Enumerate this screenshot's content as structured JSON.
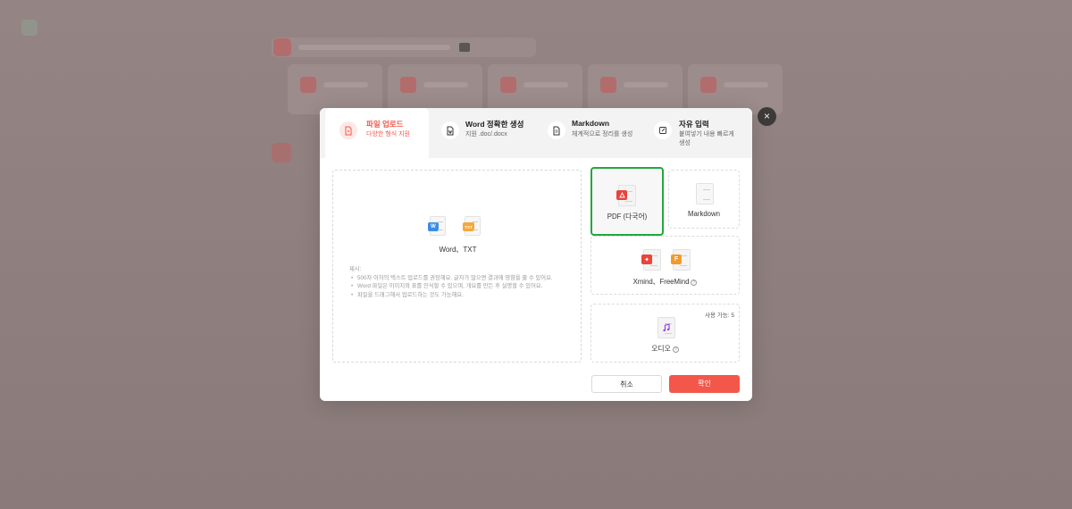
{
  "tabs": [
    {
      "title": "파일 업로드",
      "sub": "다양한 형식 지원",
      "icon": "file-upload-icon"
    },
    {
      "title": "Word 정확한 생성",
      "sub": "지원 .doc/.docx",
      "icon": "word-doc-icon"
    },
    {
      "title": "Markdown",
      "sub": "체계적으로 정리를 생성",
      "icon": "markdown-doc-icon"
    },
    {
      "title": "자유 입력",
      "sub": "붙여넣기 내용 빠르게 생성",
      "icon": "edit-icon"
    }
  ],
  "dropzone": {
    "label": "Word、TXT",
    "hint_title": "제시:",
    "hints": [
      "500자 이하의 텍스트 업로드를 권장해요. 글자가 많으면 결과에 영향을 줄 수 있어요.",
      "Word 파일은 이미지와 표를 인식할 수 있으며, 개요를 만든 후 설명할 수 있어요.",
      "파일을 드래그해서 업로드하는 것도 가능해요."
    ],
    "badges": {
      "word": "W",
      "txt": "TXT"
    }
  },
  "options": {
    "pdf": {
      "label": "PDF (다국어)"
    },
    "markdown": {
      "label": "Markdown"
    },
    "xmind": {
      "label": "Xmind、FreeMind"
    },
    "audio": {
      "label": "오디오",
      "caption": "사용 가능: 5"
    }
  },
  "buttons": {
    "cancel": "취소",
    "confirm": "확인",
    "close": "×"
  },
  "colors": {
    "accent": "#f2574a",
    "selected_border": "#22a83c"
  }
}
